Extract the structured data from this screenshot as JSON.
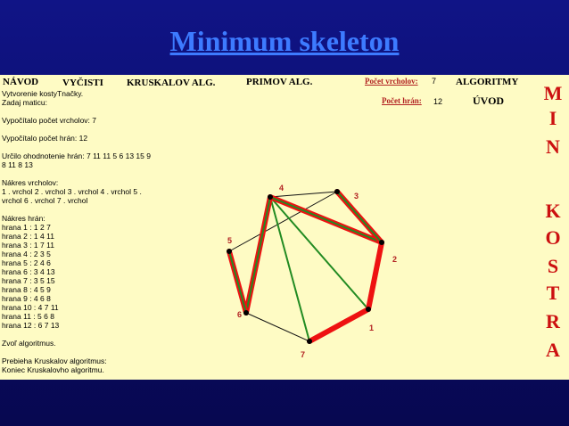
{
  "title": "Minimum skeleton",
  "menu": {
    "navod": "NÁVOD",
    "vycisti": "VYČISTI",
    "kruskal": "KRUSKALOV ALG.",
    "prim": "PRIMOV ALG.",
    "algoritmy": "ALGORITMY",
    "uvod": "ÚVOD"
  },
  "counts": {
    "vertices_label": "Počet vrcholov:",
    "vertices_value": "7",
    "edges_label": "Počet hrán:",
    "edges_value": "12"
  },
  "log": [
    "Vytvorenie kostyTnačky.",
    "Zadaj maticu:",
    "",
    "Vypočítalo počet vrcholov: 7",
    "",
    "Vypočítalo počet hrán: 12",
    "",
    "Určilo ohodnotenie hrán: 7 11 11 5 6 13 15 9",
    "8 11 8 13",
    "",
    "Nákres vrcholov:",
    " 1 . vrchol 2 . vrchol 3 . vrchol 4 . vrchol 5 .",
    "vrchol 6 . vrchol 7 . vrchol",
    "",
    "Nákres hrán:",
    "hrana 1 : 1 2 7",
    "hrana 2 : 1 4 11",
    "hrana 3 : 1 7 11",
    "hrana 4 : 2 3 5",
    "hrana 5 : 2 4 6",
    "hrana 6 : 3 4 13",
    "hrana 7 : 3 5 15",
    "hrana 8 : 4 5 9",
    "hrana 9 : 4 6 8",
    "hrana 10 : 4 7 11",
    "hrana 11 : 5 6 8",
    "hrana 12 : 6 7 13",
    "",
    "Zvoľ algoritmus.",
    "",
    "Prebieha Kruskalov algoritmus:",
    "Koniec Kruskalovho algoritmu."
  ],
  "side_letters": [
    "M",
    "I",
    "N",
    "",
    "K",
    "O",
    "S",
    "T",
    "R",
    "A"
  ],
  "graph": {
    "vertex_labels": {
      "1": "1",
      "2": "2",
      "3": "3",
      "4": "4",
      "5": "5",
      "6": "6",
      "7": "7"
    },
    "edges_black": [
      [
        "3",
        "5"
      ],
      [
        "3",
        "4"
      ],
      [
        "6",
        "7"
      ]
    ],
    "edges_green": [
      [
        "1",
        "4"
      ],
      [
        "4",
        "7"
      ]
    ],
    "edges_red_final": [
      [
        "1",
        "2"
      ],
      [
        "1",
        "7"
      ]
    ],
    "edges_red_green": [
      [
        "2",
        "4"
      ],
      [
        "4",
        "6"
      ],
      [
        "5",
        "6"
      ],
      [
        "2",
        "3"
      ]
    ],
    "colors": {
      "black": "#111111",
      "green": "#228b22",
      "red": "#ee1111",
      "vertex": "#000000",
      "label": "#b22222"
    }
  }
}
